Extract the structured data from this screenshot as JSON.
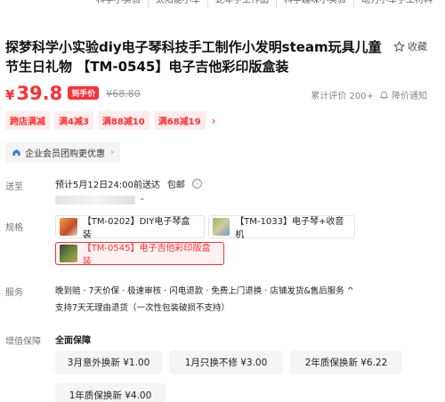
{
  "topnav": {
    "items": [
      "科学小实验",
      "太阳能小车",
      "蛇年手工作品",
      "科学趣味小实验",
      "动力小车手工材料"
    ]
  },
  "product": {
    "title": "探梦科学小实验diy电子琴科技手工制作小发明steam玩具儿童节生日礼物 【TM-0545】电子吉他彩印版盒装",
    "favorite_label": "收藏"
  },
  "price": {
    "symbol": "¥",
    "value": "39.8",
    "tag": "到手价",
    "original": "¥68.80",
    "reviews": "累计评价 200+",
    "notify": "降价通知"
  },
  "promos": [
    "跨店满减",
    "满4减3",
    "满88减10",
    "满68减19"
  ],
  "enterprise": {
    "label": "企业会员团购更优惠",
    "arrow": "›"
  },
  "delivery": {
    "label": "送至",
    "eta": "预计5月12日24:00前送达",
    "shipping": "包邮",
    "info_icon": "ⓘ"
  },
  "specs": {
    "label": "规格",
    "options": [
      {
        "label": "【TM-0202】DIY电子琴盒装",
        "selected": false
      },
      {
        "label": "【TM-1033】电子琴+收音机",
        "selected": false
      },
      {
        "label": "【TM-0545】电子吉他彩印版盒装",
        "selected": true
      }
    ]
  },
  "service": {
    "label": "服务",
    "line1": "晚到赔 · 7天价保 · 极速审核 · 闪电退款 · 免费上门退换 · 店铺发货&售后服务 ^",
    "line2": "支持7天无理由退货（一次性包装破损不支持）"
  },
  "guarantee": {
    "label": "增值保障",
    "title": "全面保障",
    "options": [
      "3月意外换新 ¥1.00",
      "1月只换不修 ¥3.00",
      "2年质保换新 ¥6.22",
      "1年质保换新 ¥4.00"
    ]
  },
  "colors": {
    "accent": "#ff2f34",
    "promo_bg": "#ffecec"
  }
}
